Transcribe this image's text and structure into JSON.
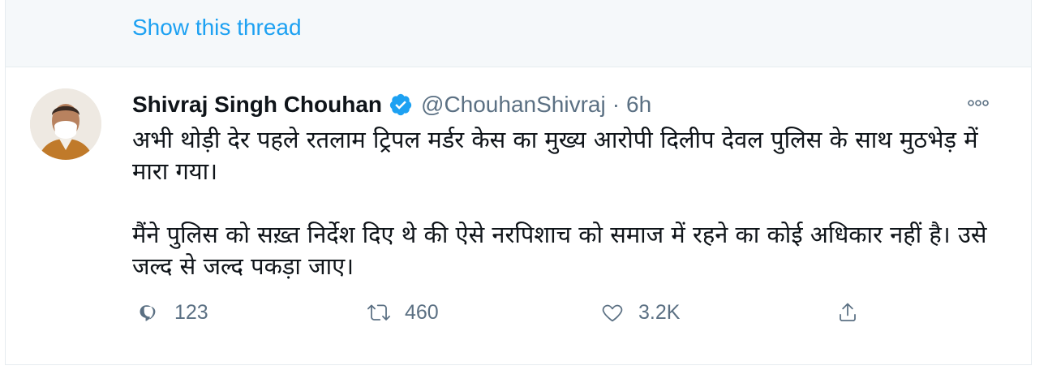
{
  "thread": {
    "show_label": "Show this thread"
  },
  "tweet": {
    "author": {
      "display_name": "Shivraj Singh Chouhan",
      "handle": "@ChouhanShivraj",
      "verified": true
    },
    "separator": "·",
    "time": "6h",
    "paragraphs": [
      "अभी थोड़ी देर पहले रतलाम ट्रिपल मर्डर केस का मुख्य आरोपी दिलीप देवल पुलिस के साथ मुठभेड़ में मारा गया।",
      "मैंने पुलिस को सख़्त निर्देश दिए थे की ऐसे नरपिशाच को समाज में रहने का कोई अधिकार नहीं है। उसे जल्द से जल्द पकड़ा जाए।"
    ],
    "stats": {
      "replies": "123",
      "retweets": "460",
      "likes": "3.2K"
    }
  },
  "icons": {
    "verified": "verified-badge-icon",
    "more": "more-options-icon",
    "reply": "reply-icon",
    "retweet": "retweet-icon",
    "like": "heart-icon",
    "share": "share-icon"
  },
  "colors": {
    "accent": "#1da1f2",
    "muted": "#5b7083",
    "text": "#0f1419",
    "verified": "#1da1f2"
  }
}
